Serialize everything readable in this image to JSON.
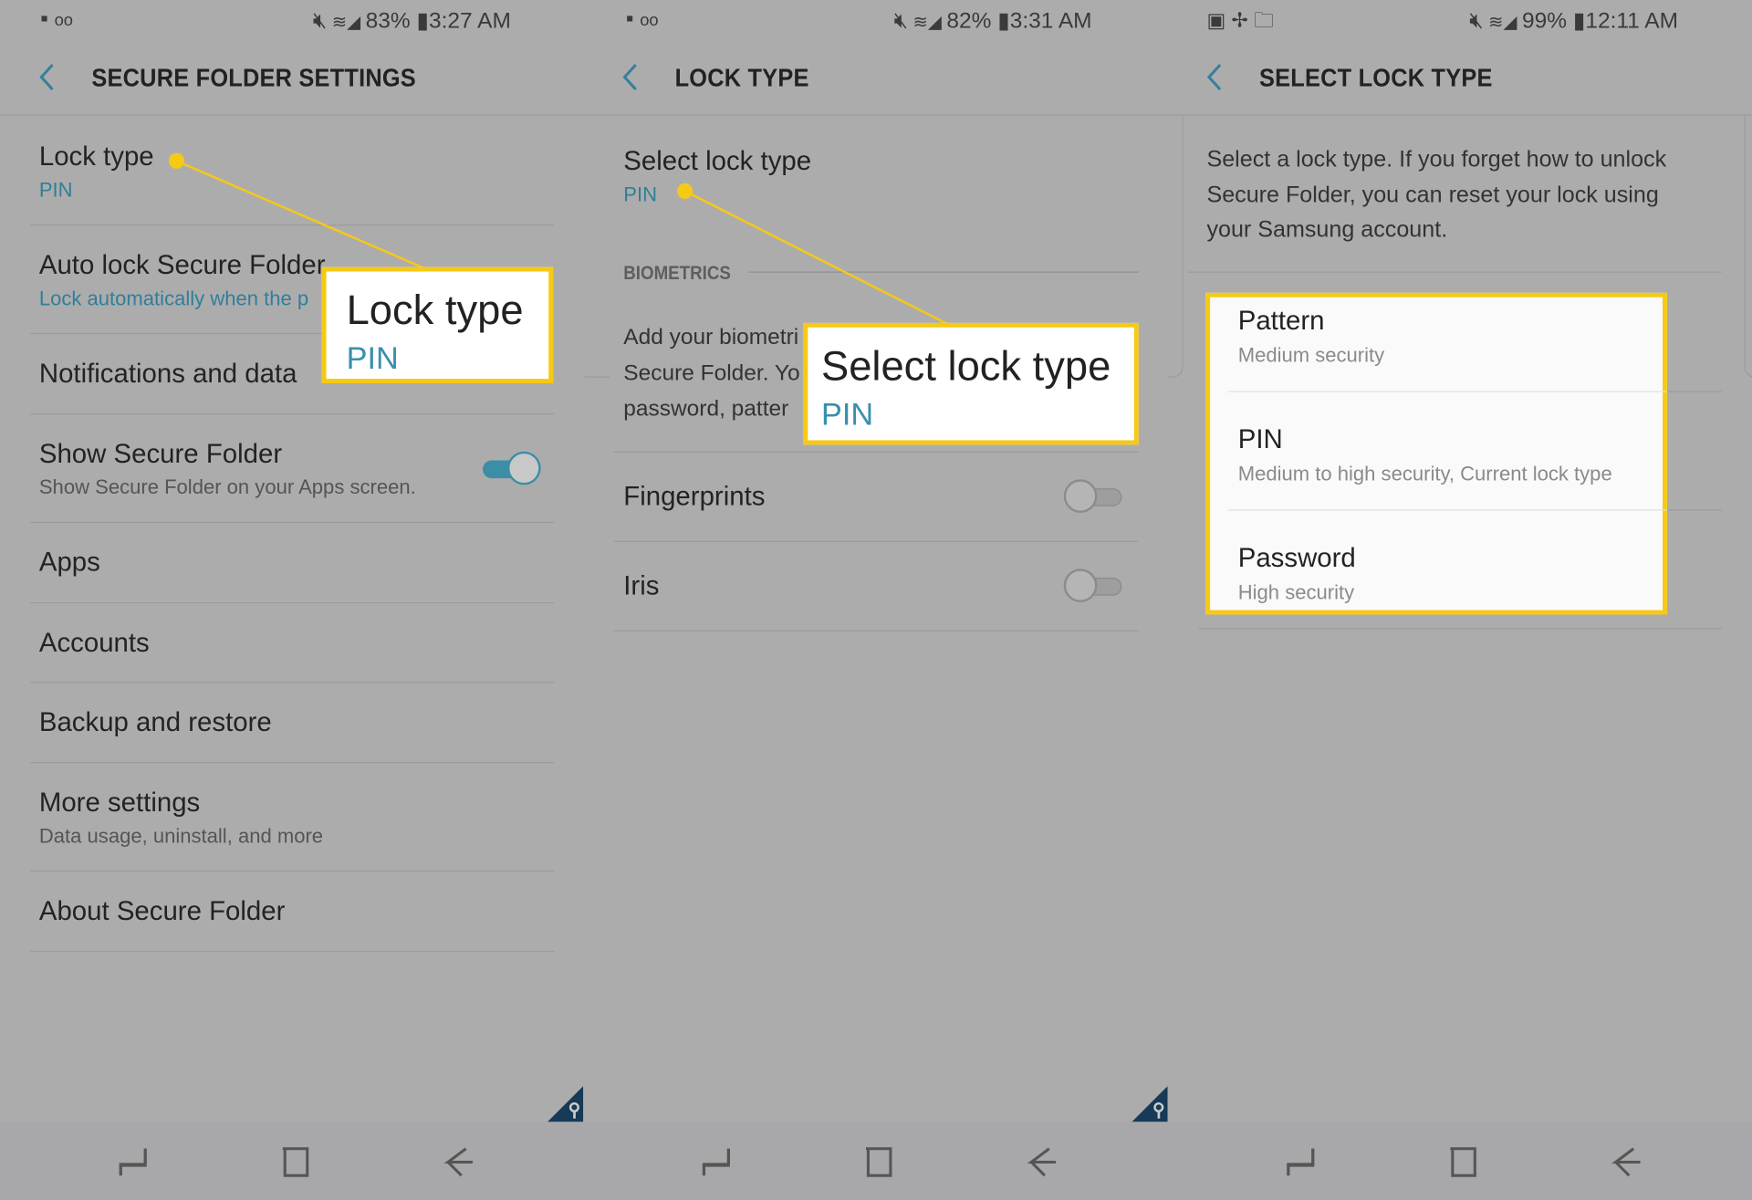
{
  "colors": {
    "accent": "#2f7f99",
    "highlight": "#f6c915",
    "toggle_on": "#3b8ea6",
    "key_badge": "#163a57"
  },
  "panels": [
    {
      "status": {
        "left_icons": [
          "message-icon",
          "voicemail-icon"
        ],
        "battery": "83%",
        "time": "3:27 AM"
      },
      "title": "SECURE FOLDER SETTINGS",
      "items": [
        {
          "title": "Lock type",
          "subtitle": "PIN"
        },
        {
          "title": "Auto lock Secure Folder",
          "subtitle": "Lock automatically when the p"
        },
        {
          "title": "Notifications and data"
        },
        {
          "title": "Show Secure Folder",
          "subtitle": "Show Secure Folder on your Apps screen.",
          "toggle": true
        },
        {
          "title": "Apps"
        },
        {
          "title": "Accounts"
        },
        {
          "title": "Backup and restore"
        },
        {
          "title": "More settings",
          "subtitle": "Data usage, uninstall, and more"
        },
        {
          "title": "About Secure Folder"
        }
      ],
      "callout": {
        "title": "Lock type",
        "value": "PIN"
      }
    },
    {
      "status": {
        "left_icons": [
          "message-icon",
          "voicemail-icon"
        ],
        "battery": "82%",
        "time": "3:31 AM"
      },
      "title": "LOCK TYPE",
      "select": {
        "title": "Select lock type",
        "subtitle": "PIN"
      },
      "section": "BIOMETRICS",
      "desc_lines": [
        "Add your biometri",
        "Secure Folder. Yo",
        "password, patter"
      ],
      "items": [
        {
          "title": "Fingerprints",
          "toggle": false
        },
        {
          "title": "Iris",
          "toggle": false
        }
      ],
      "callout": {
        "title": "Select lock type",
        "value": "PIN"
      }
    },
    {
      "status": {
        "left_icons": [
          "gallery-icon",
          "pinwheel-icon",
          "folder-sync-icon"
        ],
        "battery": "99%",
        "time": "12:11 AM"
      },
      "title": "SELECT LOCK TYPE",
      "desc_lines": [
        "Select a lock type. If you forget how to unlock",
        "Secure Folder, you can reset your lock using",
        "your Samsung account."
      ],
      "options": [
        {
          "title": "Pattern",
          "subtitle": "Medium security"
        },
        {
          "title": "PIN",
          "subtitle": "Medium to high security, Current lock type"
        },
        {
          "title": "Password",
          "subtitle": "High security"
        }
      ]
    }
  ]
}
